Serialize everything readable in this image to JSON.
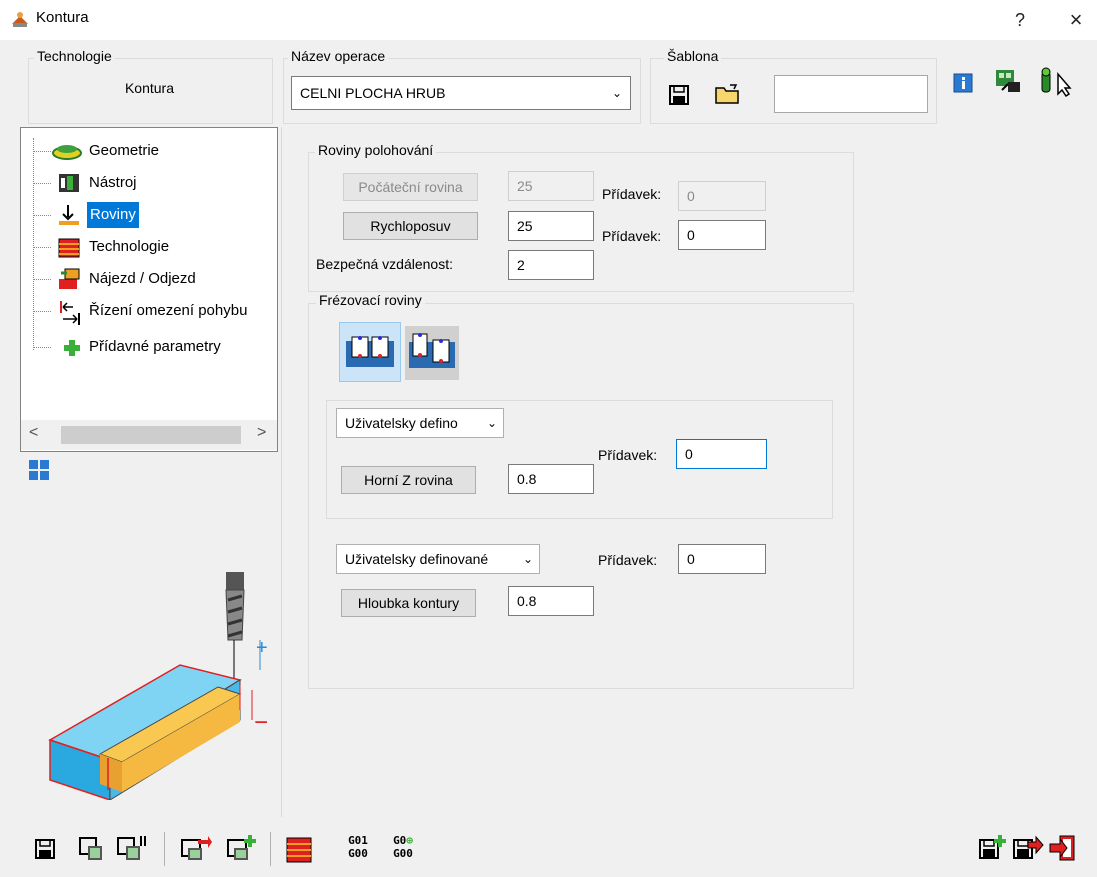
{
  "window": {
    "title": "Kontura",
    "help": "?",
    "close": "×"
  },
  "header": {
    "technologie_label": "Technologie",
    "technologie_value": "Kontura",
    "nazev_label": "Název operace",
    "nazev_value": "CELNI PLOCHA HRUB",
    "sablona_label": "Šablona",
    "sablona_value": ""
  },
  "tree": {
    "items": [
      {
        "label": "Geometrie",
        "icon": "geometry-icon"
      },
      {
        "label": "Nástroj",
        "icon": "tool-icon"
      },
      {
        "label": "Roviny",
        "icon": "planes-icon",
        "selected": true
      },
      {
        "label": "Technologie",
        "icon": "technology-icon"
      },
      {
        "label": "Nájezd / Odjezd",
        "icon": "approach-icon"
      },
      {
        "label": "Řízení omezení pohybu",
        "icon": "motion-limit-icon"
      },
      {
        "label": "Přídavné parametry",
        "icon": "add-params-icon"
      }
    ],
    "scroll_left": "<",
    "scroll_right": ">"
  },
  "roviny": {
    "title": "Roviny polohování",
    "pocatecni_label": "Počáteční rovina",
    "pocatecni_value": "25",
    "pridavek1_label": "Přídavek:",
    "pridavek1_value": "0",
    "rychlo_label": "Rychloposuv",
    "rychlo_value": "25",
    "pridavek2_label": "Přídavek:",
    "pridavek2_value": "0",
    "bezpecna_label": "Bezpečná vzdálenost:",
    "bezpecna_value": "2"
  },
  "frezovaci": {
    "title": "Frézovací roviny",
    "combo1": "Uživatelsky defino",
    "pridavek_label": "Přídavek:",
    "pridavek_value": "0",
    "horni_label": "Horní Z rovina",
    "horni_value": "0.8",
    "combo2": "Uživatelsky definované",
    "pridavek2_label": "Přídavek:",
    "pridavek2_value": "0",
    "hloubka_label": "Hloubka kontury",
    "hloubka_value": "0.8"
  },
  "preview": {
    "plus": "+",
    "minus": "−"
  },
  "toolbar": {
    "g01": "G01",
    "g00a": "G00",
    "g0": "G0",
    "g00b": "G00"
  },
  "colors": {
    "selection": "#0078d7",
    "panel": "#f0f0f0",
    "accent_red": "#e02020"
  }
}
